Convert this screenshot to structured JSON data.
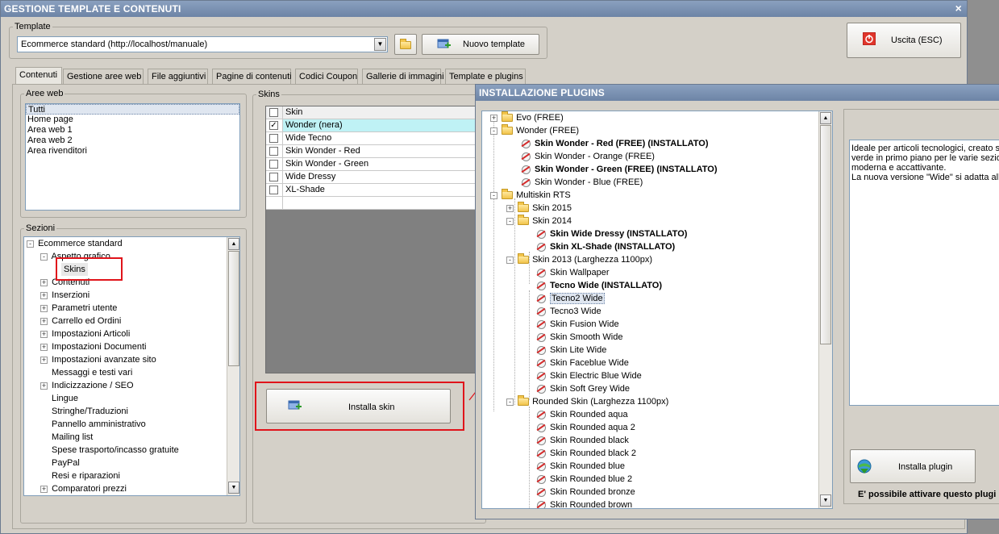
{
  "main_window": {
    "title": "GESTIONE TEMPLATE E CONTENUTI"
  },
  "template_group": {
    "legend": "Template",
    "selected": "Ecommerce standard (http://localhost/manuale)",
    "new_template_label": "Nuovo template"
  },
  "exit_button": {
    "label": "Uscita (ESC)"
  },
  "tabs": [
    "Contenuti",
    "Gestione aree web",
    "File aggiuntivi",
    "Pagine di contenuti",
    "Codici Coupon",
    "Gallerie di immagini",
    "Template e plugins"
  ],
  "aree_web": {
    "legend": "Aree web",
    "items": [
      "Tutti",
      "Home page",
      "Area web 1",
      "Area web 2",
      "Area rivenditori"
    ]
  },
  "sezioni": {
    "legend": "Sezioni",
    "root": "Ecommerce standard",
    "items": [
      {
        "label": "Aspetto grafico",
        "expanded": true
      },
      {
        "label": "Skins"
      },
      {
        "label": "Contenuti",
        "expandable": true
      },
      {
        "label": "Inserzioni",
        "expandable": true
      },
      {
        "label": "Parametri utente",
        "expandable": true
      },
      {
        "label": "Carrello ed Ordini",
        "expandable": true
      },
      {
        "label": "Impostazioni Articoli",
        "expandable": true
      },
      {
        "label": "Impostazioni Documenti",
        "expandable": true
      },
      {
        "label": "Impostazioni avanzate sito",
        "expandable": true
      },
      {
        "label": "Messaggi e testi vari"
      },
      {
        "label": "Indicizzazione / SEO",
        "expandable": true
      },
      {
        "label": "Lingue"
      },
      {
        "label": "Stringhe/Traduzioni"
      },
      {
        "label": "Pannello amministrativo"
      },
      {
        "label": "Mailing list"
      },
      {
        "label": "Spese trasporto/incasso gratuite"
      },
      {
        "label": "PayPal"
      },
      {
        "label": "Resi e riparazioni"
      },
      {
        "label": "Comparatori prezzi",
        "expandable": true
      }
    ]
  },
  "skins": {
    "legend": "Skins",
    "header": "Skin",
    "rows": [
      {
        "name": "Wonder (nera)",
        "checked": true
      },
      {
        "name": "Wide Tecno",
        "checked": false
      },
      {
        "name": "Skin Wonder - Red",
        "checked": false
      },
      {
        "name": "Skin Wonder - Green",
        "checked": false
      },
      {
        "name": "Wide Dressy",
        "checked": false
      },
      {
        "name": "XL-Shade",
        "checked": false
      }
    ],
    "install_label": "Installa skin"
  },
  "plugin_window": {
    "title": "INSTALLAZIONE PLUGINS",
    "tree": [
      {
        "label": "Evo (FREE)",
        "level": 0,
        "type": "folder",
        "toggle": "+"
      },
      {
        "label": "Wonder (FREE)",
        "level": 0,
        "type": "folder",
        "toggle": "-"
      },
      {
        "label": "Skin Wonder - Red (FREE) (INSTALLATO)",
        "level": 1,
        "type": "plugin",
        "bold": true
      },
      {
        "label": "Skin Wonder - Orange (FREE)",
        "level": 1,
        "type": "plugin"
      },
      {
        "label": "Skin Wonder - Green (FREE) (INSTALLATO)",
        "level": 1,
        "type": "plugin",
        "bold": true
      },
      {
        "label": "Skin Wonder - Blue (FREE)",
        "level": 1,
        "type": "plugin"
      },
      {
        "label": "Multiskin RTS",
        "level": 0,
        "type": "folder",
        "toggle": "-"
      },
      {
        "label": "Skin 2015",
        "level": 1,
        "type": "folder",
        "toggle": "+"
      },
      {
        "label": "Skin 2014",
        "level": 1,
        "type": "folder",
        "toggle": "-"
      },
      {
        "label": "Skin Wide Dressy (INSTALLATO)",
        "level": 2,
        "type": "plugin",
        "bold": true
      },
      {
        "label": "Skin XL-Shade (INSTALLATO)",
        "level": 2,
        "type": "plugin",
        "bold": true
      },
      {
        "label": "Skin 2013 (Larghezza 1100px)",
        "level": 1,
        "type": "folder",
        "toggle": "-"
      },
      {
        "label": "Skin Wallpaper",
        "level": 2,
        "type": "plugin"
      },
      {
        "label": "Tecno Wide (INSTALLATO)",
        "level": 2,
        "type": "plugin",
        "bold": true
      },
      {
        "label": "Tecno2 Wide",
        "level": 2,
        "type": "plugin",
        "selected": true
      },
      {
        "label": "Tecno3 Wide",
        "level": 2,
        "type": "plugin"
      },
      {
        "label": "Skin Fusion Wide",
        "level": 2,
        "type": "plugin"
      },
      {
        "label": "Skin Smooth Wide",
        "level": 2,
        "type": "plugin"
      },
      {
        "label": "Skin Lite Wide",
        "level": 2,
        "type": "plugin"
      },
      {
        "label": "Skin Faceblue Wide",
        "level": 2,
        "type": "plugin"
      },
      {
        "label": "Skin Electric Blue Wide",
        "level": 2,
        "type": "plugin"
      },
      {
        "label": "Skin Soft Grey Wide",
        "level": 2,
        "type": "plugin"
      },
      {
        "label": "Rounded Skin (Larghezza 1100px)",
        "level": 1,
        "type": "folder",
        "toggle": "-"
      },
      {
        "label": "Skin Rounded aqua",
        "level": 2,
        "type": "plugin"
      },
      {
        "label": "Skin Rounded aqua 2",
        "level": 2,
        "type": "plugin"
      },
      {
        "label": "Skin Rounded black",
        "level": 2,
        "type": "plugin"
      },
      {
        "label": "Skin Rounded black 2",
        "level": 2,
        "type": "plugin"
      },
      {
        "label": "Skin Rounded blue",
        "level": 2,
        "type": "plugin"
      },
      {
        "label": "Skin Rounded blue 2",
        "level": 2,
        "type": "plugin"
      },
      {
        "label": "Skin Rounded bronze",
        "level": 2,
        "type": "plugin"
      },
      {
        "label": "Skin Rounded brown",
        "level": 2,
        "type": "plugin"
      }
    ],
    "description": "Ideale per articoli tecnologici, creato s\nverde in primo piano per le varie sezion\nmoderna e accattivante.\nLa nuova versione \"Wide\" si adatta allo",
    "install_plugin_label": "Installa plugin",
    "footer_note": "E' possibile attivare questo plugi"
  },
  "colors": {
    "highlight_red": "#e0141b",
    "selected_row": "#bff2f5",
    "title_bar": "#7a90b2"
  }
}
